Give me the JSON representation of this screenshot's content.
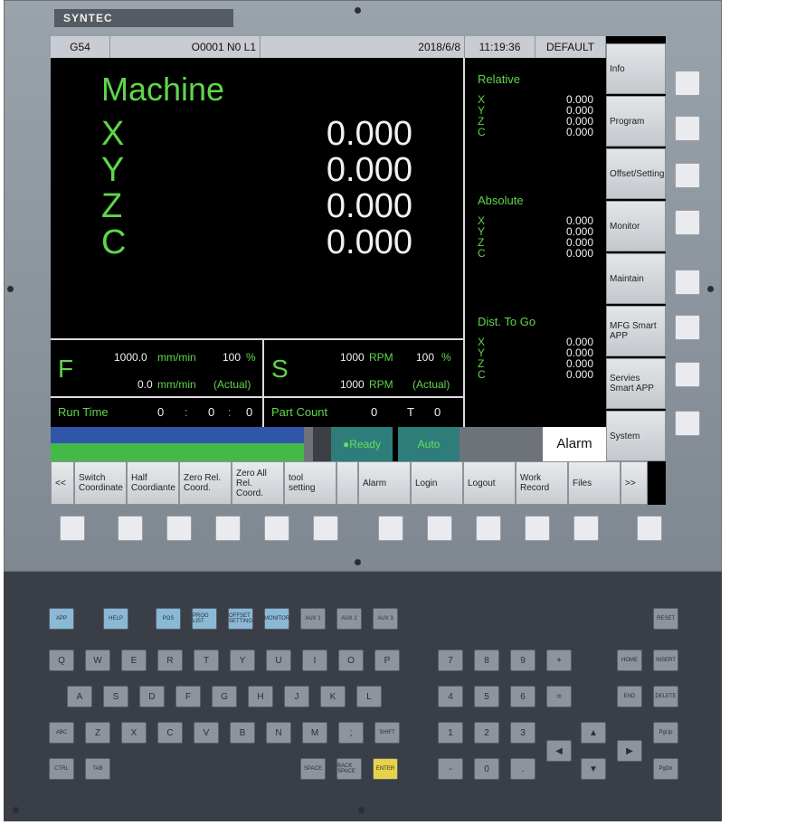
{
  "brand": "SYNTEC",
  "status_bar": {
    "coord": "G54",
    "program": "O0001 N0 L1",
    "date": "2018/6/8",
    "time": "11:19:36",
    "profile": "DEFAULT"
  },
  "machine": {
    "title": "Machine",
    "axes": [
      {
        "axis": "X",
        "value": "0.000"
      },
      {
        "axis": "Y",
        "value": "0.000"
      },
      {
        "axis": "Z",
        "value": "0.000"
      },
      {
        "axis": "C",
        "value": "0.000"
      }
    ]
  },
  "relative": {
    "title": "Relative",
    "axes": [
      {
        "axis": "X",
        "value": "0.000"
      },
      {
        "axis": "Y",
        "value": "0.000"
      },
      {
        "axis": "Z",
        "value": "0.000"
      },
      {
        "axis": "C",
        "value": "0.000"
      }
    ]
  },
  "absolute": {
    "title": "Absolute",
    "axes": [
      {
        "axis": "X",
        "value": "0.000"
      },
      {
        "axis": "Y",
        "value": "0.000"
      },
      {
        "axis": "Z",
        "value": "0.000"
      },
      {
        "axis": "C",
        "value": "0.000"
      }
    ]
  },
  "dist_to_go": {
    "title": "Dist. To Go",
    "axes": [
      {
        "axis": "X",
        "value": "0.000"
      },
      {
        "axis": "Y",
        "value": "0.000"
      },
      {
        "axis": "Z",
        "value": "0.000"
      },
      {
        "axis": "C",
        "value": "0.000"
      }
    ]
  },
  "feed": {
    "label": "F",
    "cmd_value": "1000.0",
    "cmd_unit": "mm/min",
    "override": "100",
    "pct": "%",
    "act_value": "0.0",
    "act_unit": "mm/min",
    "actual": "(Actual)"
  },
  "spindle": {
    "label": "S",
    "cmd_value": "1000",
    "cmd_unit": "RPM",
    "override": "100",
    "pct": "%",
    "act_value": "1000",
    "act_unit": "RPM",
    "actual": "(Actual)"
  },
  "runtime": {
    "label": "Run Time",
    "h": "0",
    "sep": ":",
    "m": "0",
    "s": "0"
  },
  "partcount": {
    "label": "Part Count",
    "value": "0",
    "t_label": "T",
    "t_value": "0"
  },
  "state": {
    "ready": "●Ready",
    "mode": "Auto",
    "alarm": "Alarm"
  },
  "side_menu": [
    "Info",
    "Program",
    "Offset/Setting",
    "Monitor",
    "Maintain",
    "MFG Smart APP",
    "Servies Smart APP",
    "System"
  ],
  "function_keys": [
    "<<",
    "Switch Coordinate",
    "Half Coordiante",
    "Zero Rel. Coord.",
    "Zero All Rel. Coord.",
    "tool setting",
    "",
    "Alarm",
    "Login",
    "Logout",
    "Work Record",
    "Files",
    ">>"
  ],
  "keyboard": {
    "row0": [
      "APP",
      "HELP",
      "POS",
      "PROG LIST",
      "OFFSET SETTING",
      "MONITOR",
      "AUX 1",
      "AUX 2",
      "AUX 3"
    ],
    "row1": [
      "Q",
      "W",
      "E",
      "R",
      "T",
      "Y",
      "U",
      "I",
      "O",
      "P"
    ],
    "row2": [
      "A",
      "S",
      "D",
      "F",
      "G",
      "H",
      "J",
      "K",
      "L"
    ],
    "row3": [
      "ABC",
      "Z",
      "X",
      "C",
      "V",
      "B",
      "N",
      "M",
      ";",
      "SHIFT"
    ],
    "row4": [
      "CTRL",
      "TAB",
      "SPACE",
      "BACK SPACE",
      "ENTER"
    ],
    "numpad": [
      "7",
      "8",
      "9",
      "+",
      "4",
      "5",
      "6",
      "=",
      "1",
      "2",
      "3",
      "-",
      "0",
      "."
    ],
    "nav": [
      "HOME",
      "INSERT",
      "END",
      "DELETE",
      "PgUp",
      "PgDn",
      "RESET"
    ],
    "colors": {
      "blue_key": "#8ab9d8",
      "enter_key": "#e7d34a",
      "green_text": "#5fd64a"
    }
  }
}
